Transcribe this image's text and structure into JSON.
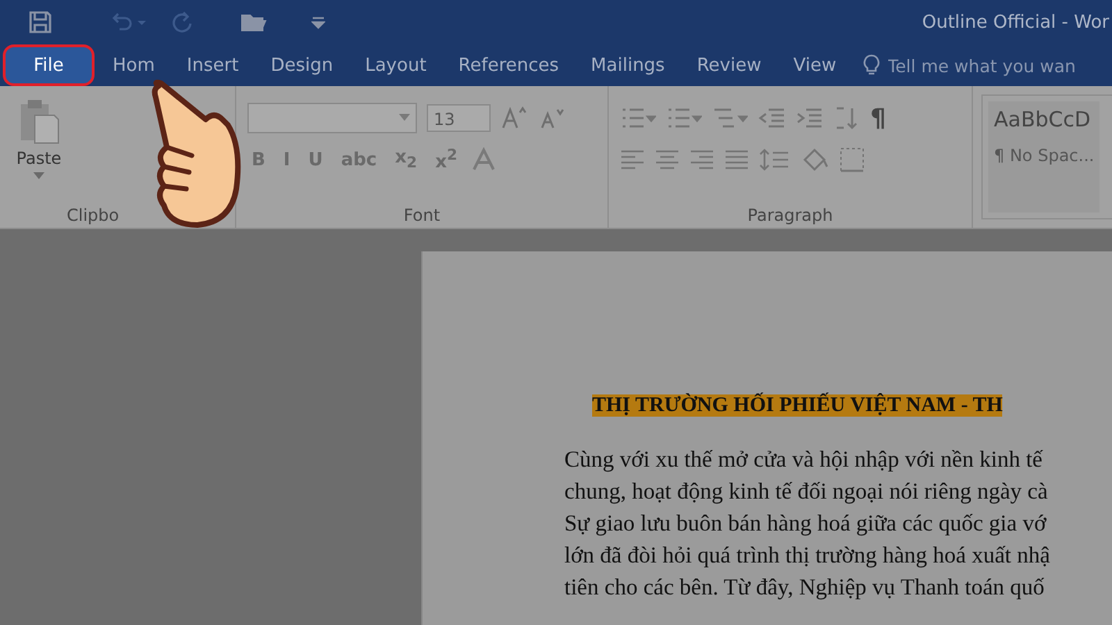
{
  "window": {
    "title": "Outline Official - Wor"
  },
  "tabs": [
    {
      "label": "File",
      "selected": true
    },
    {
      "label": "Hom",
      "selected": false
    },
    {
      "label": "Insert",
      "selected": false
    },
    {
      "label": "Design",
      "selected": false
    },
    {
      "label": "Layout",
      "selected": false
    },
    {
      "label": "References",
      "selected": false
    },
    {
      "label": "Mailings",
      "selected": false
    },
    {
      "label": "Review",
      "selected": false
    },
    {
      "label": "View",
      "selected": false
    }
  ],
  "tell_me": {
    "placeholder": "Tell me what you wan"
  },
  "ribbon": {
    "clipboard": {
      "label": "Clipbo",
      "paste_label": "Paste"
    },
    "font": {
      "label": "Font",
      "size": "13",
      "format_buttons": [
        "B",
        "I",
        "U",
        "abc",
        "x$_{2}$",
        "x$^{2}$"
      ]
    },
    "paragraph": {
      "label": "Paragraph",
      "pilcrow": "¶"
    },
    "styles": [
      {
        "preview": "AaBbCcD",
        "name": "¶ No Spac..."
      }
    ]
  },
  "document": {
    "title": "THỊ TRƯỜNG HỐI PHIẾU VIỆT NAM - TH",
    "title_highlighted": true,
    "lines": [
      "Cùng với xu thế mở cửa và hội nhập với nền kinh tế",
      "chung, hoạt động kinh tế đối ngoại nói riêng ngày cà",
      "Sự giao lưu buôn bán hàng hoá giữa các quốc gia vớ",
      "lớn đã đòi hỏi quá trình thị trường hàng hoá xuất nhậ",
      "tiên cho các bên. Từ đây, Nghiệp vụ Thanh toán quố"
    ]
  }
}
